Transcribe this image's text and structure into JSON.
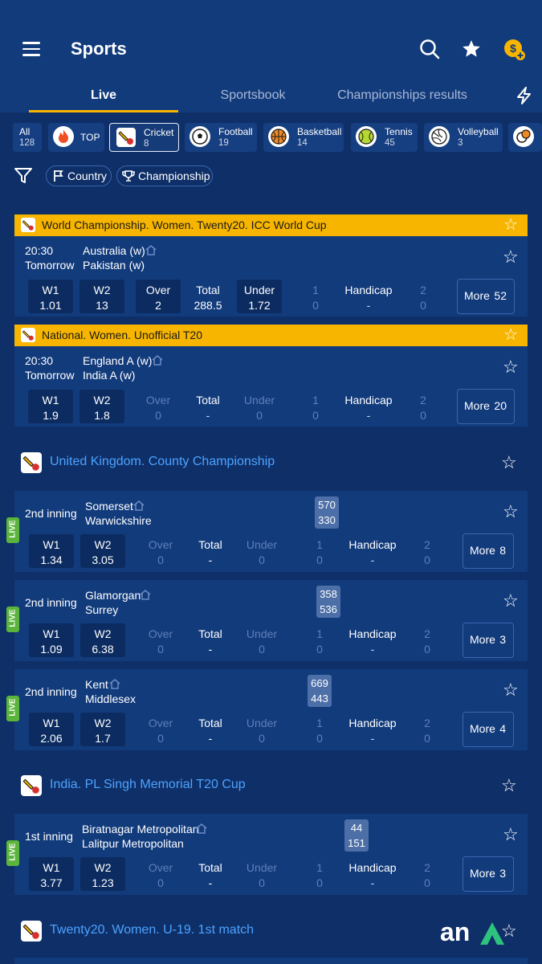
{
  "header": {
    "title": "Sports",
    "tabs": [
      "Live",
      "Sportsbook",
      "Championships results"
    ]
  },
  "sports": [
    {
      "name": "All",
      "count": "128"
    },
    {
      "name": "TOP",
      "count": ""
    },
    {
      "name": "Cricket",
      "count": "8"
    },
    {
      "name": "Football",
      "count": "19"
    },
    {
      "name": "Basketball",
      "count": "14"
    },
    {
      "name": "Tennis",
      "count": "45"
    },
    {
      "name": "Volleyball",
      "count": "3"
    }
  ],
  "filters": {
    "country": "Country",
    "championship": "Championship"
  },
  "cards": [
    {
      "league": "World Championship. Women. Twenty20. ICC World Cup",
      "time": "20:30",
      "day": "Tomorrow",
      "team1": "Australia (w)",
      "team2": "Pakistan (w)",
      "odds": {
        "w1": "1.01",
        "w2": "13",
        "over": "2",
        "total": "288.5",
        "under": "1.72",
        "h1": "1",
        "h1v": "0",
        "handicap": "-",
        "h2": "2",
        "h2v": "0"
      },
      "more": "52"
    },
    {
      "league": "National. Women. Unofficial T20",
      "time": "20:30",
      "day": "Tomorrow",
      "team1": "England A (w)",
      "team2": "India A (w)",
      "odds": {
        "w1": "1.9",
        "w2": "1.8",
        "over": "0",
        "total": "-",
        "under": "0",
        "h1": "1",
        "h1v": "0",
        "handicap": "-",
        "h2": "2",
        "h2v": "0"
      },
      "more": "20"
    }
  ],
  "leagues": [
    {
      "name": "United Kingdom. County Championship",
      "matches": [
        {
          "inning": "2nd inning",
          "team1": "Somerset",
          "team2": "Warwickshire",
          "s1": "570",
          "s2": "330",
          "w1": "1.34",
          "w2": "3.05",
          "more": "8"
        },
        {
          "inning": "2nd inning",
          "team1": "Glamorgan",
          "team2": "Surrey",
          "s1": "358",
          "s2": "536",
          "w1": "1.09",
          "w2": "6.38",
          "more": "3"
        },
        {
          "inning": "2nd inning",
          "team1": "Kent",
          "team2": "Middlesex",
          "s1": "669",
          "s2": "443",
          "w1": "2.06",
          "w2": "1.7",
          "more": "4"
        }
      ]
    },
    {
      "name": "India. PL Singh Memorial T20 Cup",
      "matches": [
        {
          "inning": "1st inning",
          "team1": "Biratnagar Metropolitan",
          "team2": "Lalitpur Metropolitan",
          "s1": "44",
          "s2": "151",
          "w1": "3.77",
          "w2": "1.23",
          "more": "3"
        }
      ]
    },
    {
      "name": "Twenty20. Women. U-19. 1st match",
      "matches": []
    }
  ],
  "labels": {
    "w1": "W1",
    "w2": "W2",
    "over": "Over",
    "total": "Total",
    "under": "Under",
    "handicap": "Handicap",
    "more": "More",
    "live": "LIVE",
    "one": "1",
    "two": "2",
    "zero": "0",
    "dash": "-"
  },
  "watermark": "an"
}
